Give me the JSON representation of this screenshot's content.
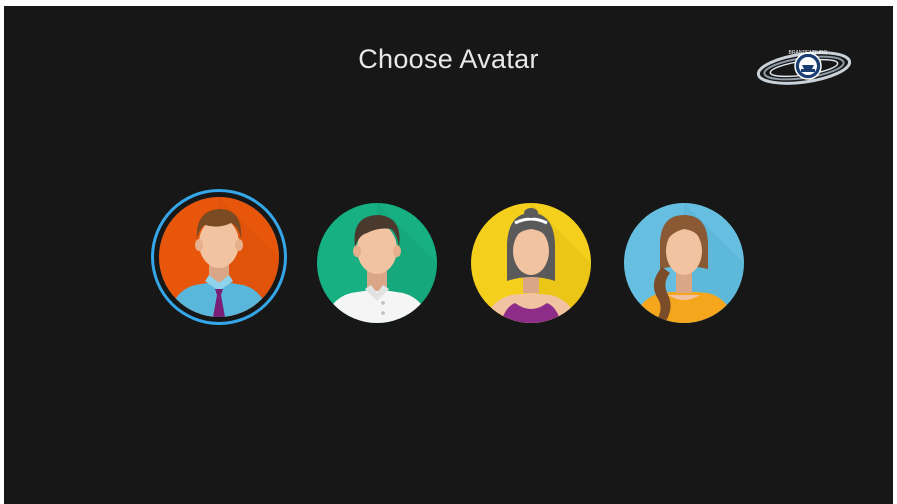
{
  "title": "Choose Avatar",
  "logo": {
    "text": "BRANDENBURG"
  },
  "avatars": [
    {
      "id": "man-business",
      "selected": true,
      "background": "#e8560c"
    },
    {
      "id": "man-casual",
      "selected": false,
      "background": "#17b083"
    },
    {
      "id": "woman-sport",
      "selected": false,
      "background": "#f4cf1c"
    },
    {
      "id": "woman-casual",
      "selected": false,
      "background": "#66bfe0"
    }
  ],
  "colors": {
    "screen_background": "#171717",
    "title_text": "#e8e8e8",
    "selection_ring": "#35a6e8"
  }
}
